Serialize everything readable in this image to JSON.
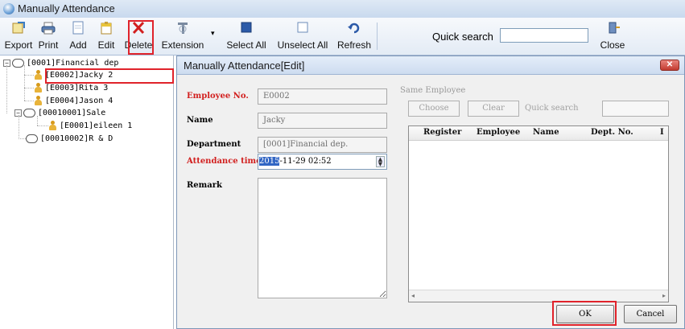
{
  "window": {
    "title": "Manually Attendance",
    "icon": "app-globe-icon"
  },
  "toolbar": {
    "buttons": [
      {
        "label": "Export",
        "icon": "export-icon"
      },
      {
        "label": "Print",
        "icon": "printer-icon"
      },
      {
        "label": "Add",
        "icon": "add-document-icon"
      },
      {
        "label": "Edit",
        "icon": "edit-icon"
      },
      {
        "label": "Delete",
        "icon": "delete-icon"
      },
      {
        "label": "Extension",
        "icon": "extension-icon"
      },
      {
        "label": "Select All",
        "icon": "select-all-icon"
      },
      {
        "label": "Unselect All",
        "icon": "unselect-all-icon"
      },
      {
        "label": "Refresh",
        "icon": "refresh-icon"
      },
      {
        "label": "Close",
        "icon": "close-door-icon"
      }
    ],
    "quick_search_label": "Quick search",
    "quick_search_value": ""
  },
  "tree": {
    "nodes": [
      {
        "label": "[0001]Financial dep"
      },
      {
        "label": "[E0002]Jacky  2"
      },
      {
        "label": "[E0003]Rita  3"
      },
      {
        "label": "[E0004]Jason  4"
      },
      {
        "label": "[00010001]Sale"
      },
      {
        "label": "[E0001]eileen  1"
      },
      {
        "label": "[00010002]R & D"
      }
    ]
  },
  "dialog": {
    "title": "Manually Attendance[Edit]",
    "fields": {
      "employee_no": {
        "label": "Employee No.",
        "value": "E0002"
      },
      "name": {
        "label": "Name",
        "value": "Jacky"
      },
      "department": {
        "label": "Department",
        "value": "[0001]Financial dep."
      },
      "attendance_time": {
        "label": "Attendance time",
        "year": "2015",
        "rest": "-11-29 02:52"
      },
      "remark": {
        "label": "Remark",
        "value": ""
      }
    },
    "same_employee": {
      "label": "Same Employee",
      "choose": "Choose",
      "clear": "Clear",
      "quick_search": "Quick search",
      "columns": [
        "Register",
        "Employee",
        "Name",
        "Dept. No.",
        "I"
      ]
    },
    "ok": "OK",
    "cancel": "Cancel"
  },
  "colors": {
    "highlight": "#e0232b",
    "required_label": "#d2201f",
    "selection": "#3166c4"
  }
}
